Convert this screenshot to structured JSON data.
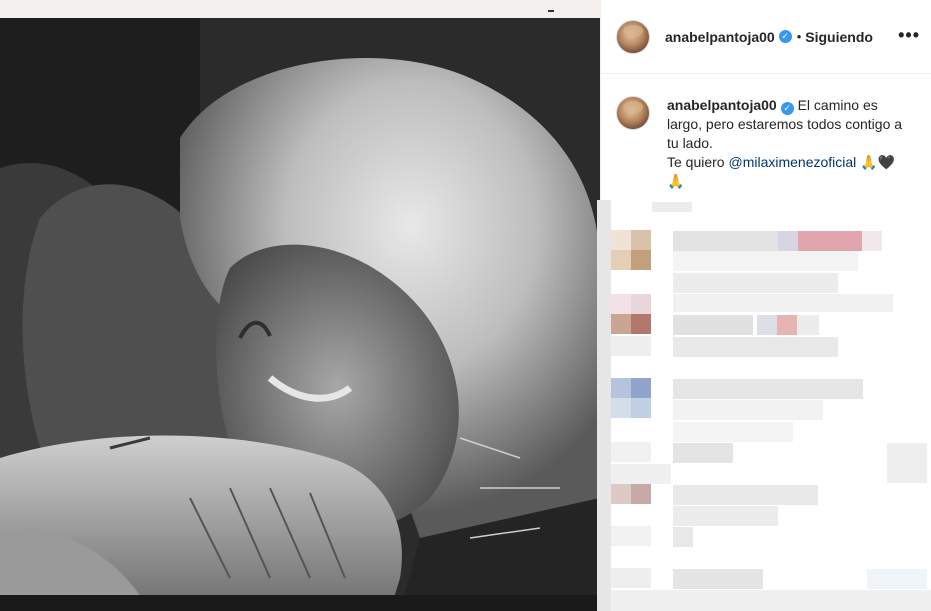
{
  "post": {
    "username": "anabelpantoja00",
    "verified_icon": "verified-badge-icon",
    "separator": "•",
    "follow_status": "Siguiendo",
    "more_label": "•••"
  },
  "caption": {
    "username": "anabelpantoja00",
    "text_1": " El camino es largo, pero estaremos todos contigo a tu lado.",
    "text_2": "Te quiero ",
    "mention": "@milaximenezoficial",
    "emoji_pray": "🙏",
    "emoji_heart": "🖤",
    "emoji_pray_2": "🙏"
  },
  "colors": {
    "verified": "#3897f0",
    "mention": "#00376b",
    "text": "#262626",
    "divider": "#efefef"
  }
}
